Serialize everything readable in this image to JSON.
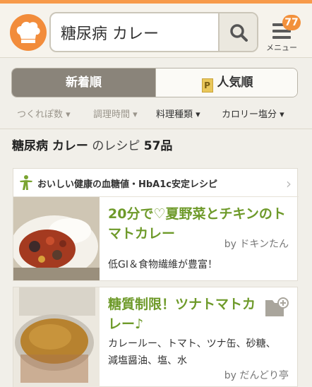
{
  "header": {
    "search_value": "糖尿病 カレー",
    "menu_label": "メニュー",
    "menu_badge": "77"
  },
  "tabs": {
    "new_label": "新着順",
    "popular_label": "人気順",
    "popular_icon_text": "P"
  },
  "filters": [
    {
      "label": "つくれぽ数 ▾"
    },
    {
      "label": "調理時間 ▾"
    },
    {
      "label": "料理種類 ▾"
    },
    {
      "label": "カロリー塩分 ▾"
    }
  ],
  "results": {
    "query": "糖尿病 カレー",
    "suffix": "のレシピ",
    "count": "57品"
  },
  "banner": {
    "text": "おいしい健康の血糖値・HbA1c安定レシピ",
    "chevron": "›"
  },
  "recipes": [
    {
      "title_line1": "20分で♡夏野菜とチキンのト",
      "title_line2": "マトカレー",
      "author": "by ドキンたん",
      "description": "低GI＆食物繊維が豊富！"
    },
    {
      "title_line1": "糖質制限！ツナトマトカ",
      "title_line2": "レー♪",
      "ingredients_line1": "カレールー、トマト、ツナ缶、砂糖、",
      "ingredients_line2": "減塩醤油、塩、水",
      "author": "by だんどり亭"
    }
  ],
  "colors": {
    "accent": "#f28c3b",
    "title_green": "#6e9a2a",
    "tab_active": "#8a847a"
  },
  "icons": {
    "logo": "chef-hat-icon",
    "search": "search-icon",
    "menu": "hamburger-icon",
    "banner": "person-exercise-icon",
    "folder": "folder-add-icon"
  }
}
